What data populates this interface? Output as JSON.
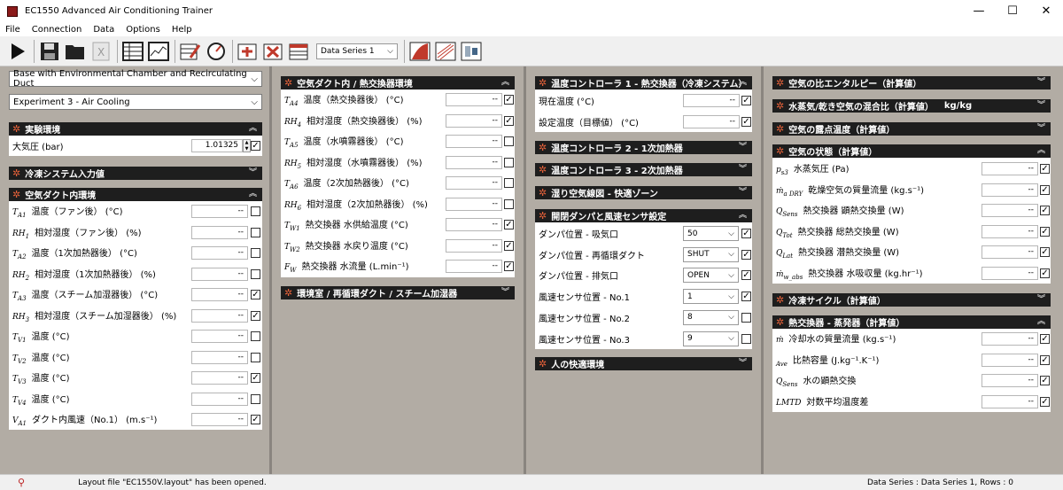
{
  "window": {
    "title": "EC1550 Advanced Air Conditioning Trainer"
  },
  "menu": [
    "File",
    "Connection",
    "Data",
    "Options",
    "Help"
  ],
  "toolbar": {
    "data_series": "Data Series 1"
  },
  "col1": {
    "combo1": "Base with Environmental Chamber and Recirculating Duct",
    "combo2": "Experiment 3 - Air Cooling",
    "exp_env": {
      "title": "実験環境",
      "label": "大気圧 (bar)",
      "value": "1.01325",
      "checked": true
    },
    "refrig": {
      "title": "冷凍システム入力値"
    },
    "duct": {
      "title": "空気ダクト内環境",
      "rows": [
        {
          "sym": "T",
          "sub": "A1",
          "label": "温度（ファン後） (°C)",
          "value": "--",
          "checked": false
        },
        {
          "sym": "RH",
          "sub": "1",
          "label": "相対湿度（ファン後） (%)",
          "value": "--",
          "checked": false
        },
        {
          "sym": "T",
          "sub": "A2",
          "label": "温度（1次加熱器後） (°C)",
          "value": "--",
          "checked": false
        },
        {
          "sym": "RH",
          "sub": "2",
          "label": "相対湿度（1次加熱器後） (%)",
          "value": "--",
          "checked": false
        },
        {
          "sym": "T",
          "sub": "A3",
          "label": "温度（スチーム加湿器後） (°C)",
          "value": "--",
          "checked": true
        },
        {
          "sym": "RH",
          "sub": "3",
          "label": "相対湿度（スチーム加湿器後） (%)",
          "value": "--",
          "checked": true
        },
        {
          "sym": "T",
          "sub": "V1",
          "label": "温度 (°C)",
          "value": "--",
          "checked": false
        },
        {
          "sym": "T",
          "sub": "V2",
          "label": "温度 (°C)",
          "value": "--",
          "checked": false
        },
        {
          "sym": "T",
          "sub": "V3",
          "label": "温度 (°C)",
          "value": "--",
          "checked": true
        },
        {
          "sym": "T",
          "sub": "V4",
          "label": "温度 (°C)",
          "value": "--",
          "checked": false
        },
        {
          "sym": "V",
          "sub": "A1",
          "label": "ダクト内風速（No.1） (m.s⁻¹)",
          "value": "--",
          "checked": true
        }
      ]
    }
  },
  "col2": {
    "hx": {
      "title": "空気ダクト内 / 熱交換器環境",
      "rows": [
        {
          "sym": "T",
          "sub": "A4",
          "label": "温度（熱交換器後） (°C)",
          "value": "--",
          "checked": true
        },
        {
          "sym": "RH",
          "sub": "4",
          "label": "相対湿度（熱交換器後） (%)",
          "value": "--",
          "checked": true
        },
        {
          "sym": "T",
          "sub": "A5",
          "label": "温度（水噴霧器後） (°C)",
          "value": "--",
          "checked": false
        },
        {
          "sym": "RH",
          "sub": "5",
          "label": "相対湿度（水噴霧器後） (%)",
          "value": "--",
          "checked": false
        },
        {
          "sym": "T",
          "sub": "A6",
          "label": "温度（2次加熱器後） (°C)",
          "value": "--",
          "checked": false
        },
        {
          "sym": "RH",
          "sub": "6",
          "label": "相対湿度（2次加熱器後） (%)",
          "value": "--",
          "checked": false
        },
        {
          "sym": "T",
          "sub": "W1",
          "label": "熱交換器 水供給温度 (°C)",
          "value": "--",
          "checked": true
        },
        {
          "sym": "T",
          "sub": "W2",
          "label": "熱交換器 水戻り温度 (°C)",
          "value": "--",
          "checked": true
        },
        {
          "sym": "F",
          "sub": "W",
          "label": "熱交換器 水流量 (L.min⁻¹)",
          "value": "--",
          "checked": true
        }
      ]
    },
    "chamber": {
      "title": "環境室 / 再循環ダクト / スチーム加湿器"
    }
  },
  "col3": {
    "tc1": {
      "title": "温度コントローラ 1 - 熱交換器（冷凍システム）",
      "rows": [
        {
          "label": "現在温度 (°C)",
          "value": "--",
          "checked": true
        },
        {
          "label": "設定温度（目標値） (°C)",
          "value": "--",
          "checked": true
        }
      ]
    },
    "tc2": {
      "title": "温度コントローラ 2 - 1次加熱器"
    },
    "tc3": {
      "title": "温度コントローラ 3 - 2次加熱器"
    },
    "psy": {
      "title": "湿り空気線図 - 快適ゾーン"
    },
    "damper": {
      "title": "開閉ダンパと風速センサ設定",
      "rows": [
        {
          "label": "ダンパ位置 - 吸気口",
          "value": "50",
          "checked": true
        },
        {
          "label": "ダンパ位置 - 再循環ダクト",
          "value": "SHUT",
          "checked": true
        },
        {
          "label": "ダンパ位置 - 排気口",
          "value": "OPEN",
          "checked": true
        },
        {
          "label": "風速センサ位置 - No.1",
          "value": "1",
          "checked": true
        },
        {
          "label": "風速センサ位置 - No.2",
          "value": "8",
          "checked": false
        },
        {
          "label": "風速センサ位置 - No.3",
          "value": "9",
          "checked": false
        }
      ]
    },
    "comfort": {
      "title": "人の快適環境"
    }
  },
  "col4": {
    "enthalpy": {
      "title": "空気の比エンタルピー（計算値）"
    },
    "mix": {
      "title": "水蒸気/乾き空気の混合比（計算値）",
      "unit": "kg/kg"
    },
    "dew": {
      "title": "空気の露点温度（計算値）"
    },
    "state": {
      "title": "空気の状態（計算値）",
      "rows": [
        {
          "sym": "p",
          "sub": "s3",
          "label": "水蒸気圧 (Pa)",
          "value": "--",
          "checked": true
        },
        {
          "sym": "ṁ",
          "sub": "a DRY",
          "label": "乾燥空気の質量流量 (kg.s⁻¹)",
          "value": "--",
          "checked": true
        },
        {
          "sym": "Q",
          "sub": "Sens",
          "label": "熱交換器 顕熱交換量 (W)",
          "value": "--",
          "checked": true
        },
        {
          "sym": "Q",
          "sub": "Tot",
          "label": "熱交換器 総熱交換量 (W)",
          "value": "--",
          "checked": true
        },
        {
          "sym": "Q",
          "sub": "Lat",
          "label": "熱交換器 潜熱交換量 (W)",
          "value": "--",
          "checked": true
        },
        {
          "sym": "ṁ",
          "sub": "w_abs",
          "label": "熱交換器 水吸収量 (kg.hr⁻¹)",
          "value": "--",
          "checked": true
        }
      ]
    },
    "cycle": {
      "title": "冷凍サイクル（計算値）"
    },
    "evap": {
      "title": "熱交換器 - 蒸発器（計算値）",
      "rows": [
        {
          "sym": "ṁ",
          "sub": "",
          "label": "冷却水の質量流量 (kg.s⁻¹)",
          "value": "--",
          "checked": true
        },
        {
          "sym": "",
          "sub": "Ave",
          "label": "比熱容量 (J.kg⁻¹.K⁻¹)",
          "value": "--",
          "checked": true
        },
        {
          "sym": "Q",
          "sub": "Sens",
          "label": "水の顕熱交換",
          "value": "--",
          "checked": true
        },
        {
          "sym": "LMTD",
          "sub": "",
          "label": "対数平均温度差",
          "value": "--",
          "checked": true
        }
      ]
    }
  },
  "status": {
    "message": "Layout file \"EC1550V.layout\" has been opened.",
    "right": "Data Series : Data Series 1,   Rows : 0"
  }
}
